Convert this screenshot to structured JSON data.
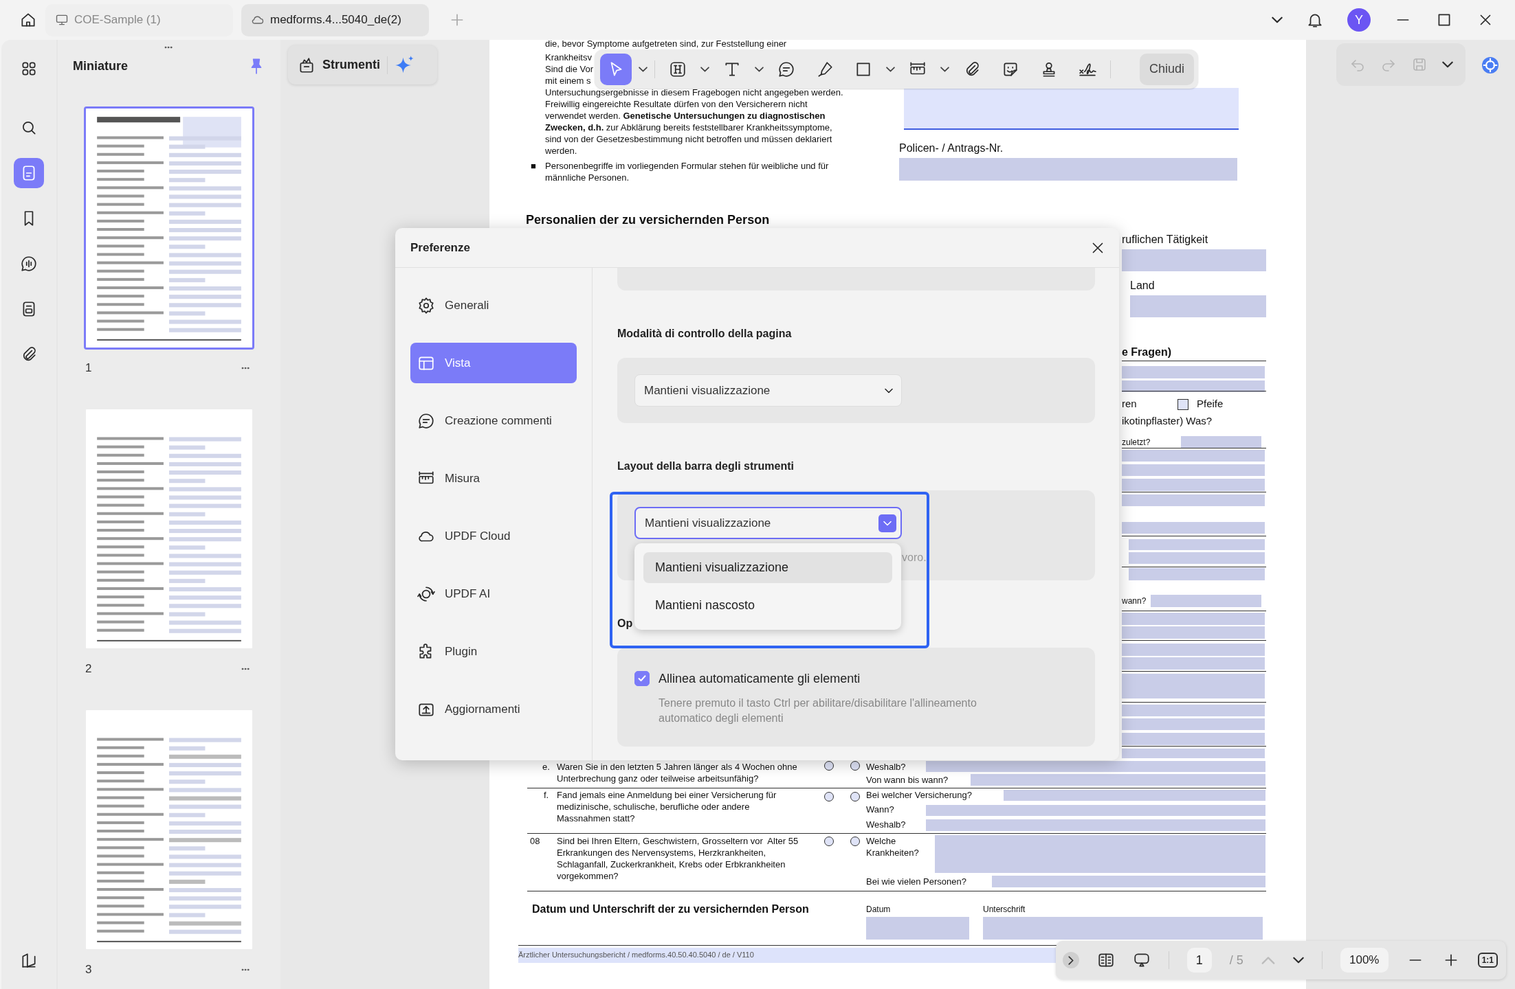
{
  "tabs": [
    {
      "label": "COE-Sample (1)",
      "kind": "local",
      "selected": false
    },
    {
      "label": "medforms.4...5040_de(2)",
      "kind": "cloud",
      "selected": true
    }
  ],
  "account": {
    "initial": "Y"
  },
  "rail": [
    {
      "kind": "search",
      "selected": false
    },
    {
      "kind": "pages",
      "selected": true
    },
    {
      "kind": "bookmark",
      "selected": false
    },
    {
      "kind": "chat",
      "selected": false
    },
    {
      "kind": "form",
      "selected": false
    },
    {
      "kind": "attachment",
      "selected": false
    }
  ],
  "thumbnails": {
    "title": "Miniature",
    "pages": [
      {
        "number": "1",
        "selected": true
      },
      {
        "number": "2",
        "selected": false
      },
      {
        "number": "3",
        "selected": false
      }
    ]
  },
  "tools_button": {
    "label": "Strumenti"
  },
  "toolbar": {
    "tools": [
      {
        "kind": "select",
        "selected": true,
        "dropdown": true
      },
      {
        "kind": "heading",
        "selected": false,
        "dropdown": true
      },
      {
        "kind": "text",
        "selected": false,
        "dropdown": true
      },
      {
        "kind": "comment",
        "selected": false,
        "dropdown": false
      },
      {
        "kind": "pen",
        "selected": false,
        "dropdown": false
      },
      {
        "kind": "shape",
        "selected": false,
        "dropdown": true
      },
      {
        "kind": "measure",
        "selected": false,
        "dropdown": true
      },
      {
        "kind": "attachment",
        "selected": false,
        "dropdown": false
      },
      {
        "kind": "sticker",
        "selected": false,
        "dropdown": false
      },
      {
        "kind": "stamp",
        "selected": false,
        "dropdown": false
      },
      {
        "kind": "signature",
        "selected": false,
        "dropdown": false
      }
    ],
    "close": "Chiudi"
  },
  "document": {
    "texts": [
      {
        "kind": "text",
        "text": "die, bevor Symptome aufgetreten sind, zur Feststellung einer"
      },
      {
        "kind": "text",
        "text": "Krankheitsv"
      },
      {
        "kind": "text",
        "text": "Sind die Vor"
      },
      {
        "kind": "text",
        "text": "mit einem s"
      },
      {
        "kind": "text",
        "text": "Untersuchungsergebnisse in diesem Fragebogen nicht angegeben werden.\nFreiwillig eingereichte Resultate dürfen von den Versicherern nicht\nverwendet werden. **Genetische Untersuchungen zu diagnostischen**\n**Zwecken, d.h.** zur Abklärung bereits feststellbarer Krankheitssymptome,\nsind von der Gesetzesbestimmung nicht betroffen und müssen deklariert\nwerden."
      },
      {
        "kind": "bullet",
        "text": "■"
      },
      {
        "kind": "text",
        "text": "Personenbegriffe im vorliegenden Formular stehen für weibliche und für\nmännliche Personen."
      },
      {
        "kind": "label",
        "text": "Policen- / Antrags-Nr."
      },
      {
        "kind": "heading",
        "text": "Personalien der zu versichernden Person"
      },
      {
        "kind": "label",
        "text": "ruflichen Tätigkeit"
      },
      {
        "kind": "label",
        "text": "Land"
      },
      {
        "kind": "subheading",
        "text": "e Fragen)"
      },
      {
        "kind": "medium",
        "text": "ren"
      },
      {
        "kind": "medium",
        "text": "Pfeife"
      },
      {
        "kind": "medium",
        "text": "ikotinpflaster) Was?"
      },
      {
        "kind": "small",
        "text": "zuletzt?"
      },
      {
        "kind": "small",
        "text": "wann?"
      },
      {
        "kind": "text",
        "text": "e."
      },
      {
        "kind": "text",
        "text": "Waren Sie in den letzten 5 Jahren länger als 4 Wochen ohne\nUnterbrechung ganz oder teilweise arbeitsunfähig?"
      },
      {
        "kind": "text",
        "text": "Weshalb?"
      },
      {
        "kind": "text",
        "text": "Von wann bis wann?"
      },
      {
        "kind": "text",
        "text": "f."
      },
      {
        "kind": "text",
        "text": "Fand jemals eine Anmeldung bei einer Versicherung für\nmedizinische, schulische, berufliche oder andere\nMassnahmen statt?"
      },
      {
        "kind": "text",
        "text": "Bei welcher Versicherung?"
      },
      {
        "kind": "text",
        "text": "Wann?"
      },
      {
        "kind": "text",
        "text": "Weshalb?"
      },
      {
        "kind": "text",
        "text": "08"
      },
      {
        "kind": "text",
        "text": "Sind bei Ihren Eltern, Geschwistern, Grosseltern vor  Alter 55\nErkrankungen des Nervensystems, Herzkrankheiten,\nSchlaganfall, Zuckerkrankheit, Krebs oder Erbkrankheiten\nvorgekommen?"
      },
      {
        "kind": "text",
        "text": "Welche\nKrankheiten?"
      },
      {
        "kind": "text",
        "text": "Bei wie vielen Personen?"
      },
      {
        "kind": "subheading",
        "text": "Datum und Unterschrift der zu versichernden Person"
      },
      {
        "kind": "small",
        "text": "Datum"
      },
      {
        "kind": "small",
        "text": "Unterschrift"
      },
      {
        "kind": "footer",
        "text": "Ärztlicher Untersuchungsbericht / medforms.40.50.40.5040 / de / V110"
      }
    ],
    "checkboxes": [
      {
        "checked": false
      }
    ],
    "radios": [
      {
        "selected": false
      },
      {
        "selected": false
      },
      {
        "selected": false
      },
      {
        "selected": false
      },
      {
        "selected": false
      },
      {
        "selected": false
      }
    ]
  },
  "page_nav": {
    "page": "1",
    "total": "/ 5",
    "zoom": "100%",
    "ratio": "1:1",
    "prev_disabled": true
  },
  "dialog": {
    "title": "Preferenze",
    "nav": [
      {
        "kind": "general",
        "label": "Generali",
        "selected": false
      },
      {
        "kind": "view",
        "label": "Vista",
        "selected": true
      },
      {
        "kind": "comment",
        "label": "Creazione commenti",
        "selected": false
      },
      {
        "kind": "measure",
        "label": "Misura",
        "selected": false
      },
      {
        "kind": "cloud",
        "label": "UPDF Cloud",
        "selected": false
      },
      {
        "kind": "ai",
        "label": "UPDF AI",
        "selected": false
      },
      {
        "kind": "plugin",
        "label": "Plugin",
        "selected": false
      },
      {
        "kind": "update",
        "label": "Aggiornamenti",
        "selected": false
      }
    ],
    "sections": [
      {
        "heading": "Modalità di controllo della pagina",
        "select": {
          "value": "Mantieni visualizzazione",
          "open": false
        }
      },
      {
        "heading": "Layout della barra degli strumenti",
        "select": {
          "value": "Mantieni visualizzazione",
          "open": true,
          "options": [
            {
              "label": "Mantieni visualizzazione",
              "selected": true
            },
            {
              "label": "Mantieni nascosto",
              "selected": false
            }
          ]
        },
        "hint": "voro."
      },
      {
        "heading": "Op",
        "checkbox": {
          "label": "Allinea automaticamente gli elementi",
          "checked": true,
          "description": "Tenere premuto il tasto Ctrl per abilitare/disabilitare l'allineamento\nautomatico degli elementi"
        }
      }
    ]
  }
}
